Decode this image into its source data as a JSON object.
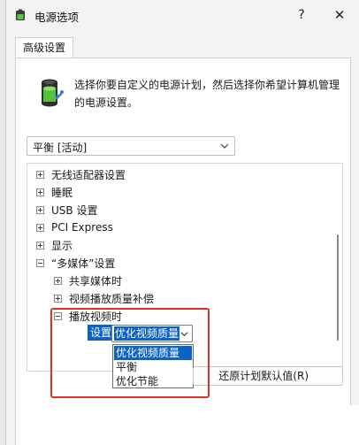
{
  "window": {
    "title": "电源选项",
    "help_label": "?",
    "close_label": "✕"
  },
  "tab": {
    "label": "高级设置"
  },
  "description": "选择你要自定义的电源计划，然后选择你希望计算机管理的电源设置。",
  "plan": {
    "selected": "平衡 [活动]"
  },
  "tree": {
    "items": [
      {
        "label": "无线适配器设置",
        "expander": "plus"
      },
      {
        "label": "睡眠",
        "expander": "plus"
      },
      {
        "label": "USB 设置",
        "expander": "plus"
      },
      {
        "label": "PCI Express",
        "expander": "plus"
      },
      {
        "label": "显示",
        "expander": "plus"
      },
      {
        "label": "“多媒体”设置",
        "expander": "minus"
      },
      {
        "label": "共享媒体时",
        "expander": "plus"
      },
      {
        "label": "视频播放质量补偿",
        "expander": "plus"
      },
      {
        "label": "播放视频时",
        "expander": "minus"
      }
    ]
  },
  "setting": {
    "label": "设置:",
    "selected": "优化视频质量",
    "options": [
      "优化视频质量",
      "平衡",
      "优化节能"
    ]
  },
  "restore_button": "还原计划默认值(R)",
  "colors": {
    "accent": "#0a64c8",
    "highlight": "#e0302a"
  }
}
